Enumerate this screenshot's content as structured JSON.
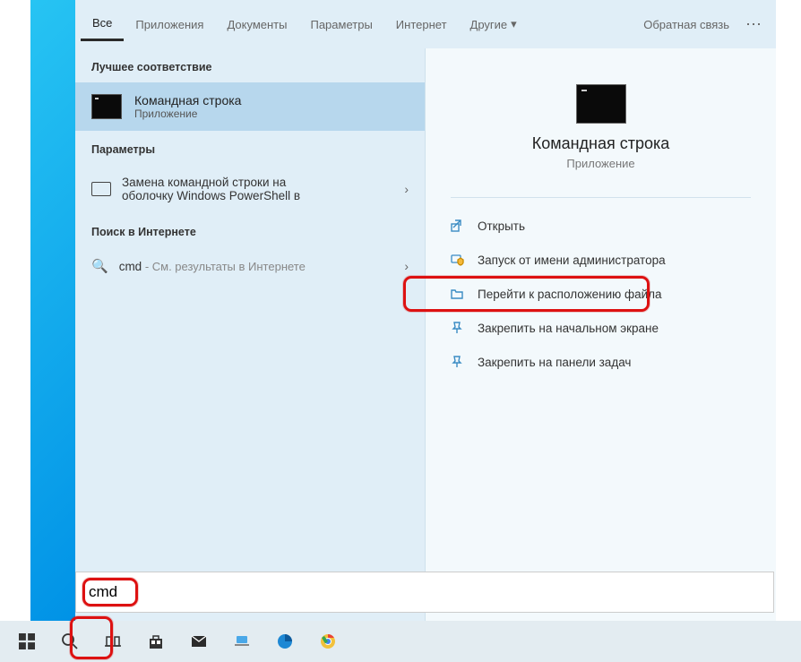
{
  "tabs": {
    "all": "Все",
    "apps": "Приложения",
    "docs": "Документы",
    "settings": "Параметры",
    "internet": "Интернет",
    "more": "Другие"
  },
  "header": {
    "feedback": "Обратная связь"
  },
  "sections": {
    "best": "Лучшее соответствие",
    "settings": "Параметры",
    "web": "Поиск в Интернете"
  },
  "best_match": {
    "title": "Командная строка",
    "sub": "Приложение"
  },
  "settings_row": {
    "line1": "Замена командной строки на",
    "line2": "оболочку Windows PowerShell в"
  },
  "web_row": {
    "query": "cmd",
    "suffix": " - См. результаты в Интернете"
  },
  "preview": {
    "title": "Командная строка",
    "sub": "Приложение"
  },
  "actions": {
    "open": "Открыть",
    "admin": "Запуск от имени администратора",
    "location": "Перейти к расположению файла",
    "pin_start": "Закрепить на начальном экране",
    "pin_taskbar": "Закрепить на панели задач"
  },
  "search": {
    "value": "cmd"
  }
}
